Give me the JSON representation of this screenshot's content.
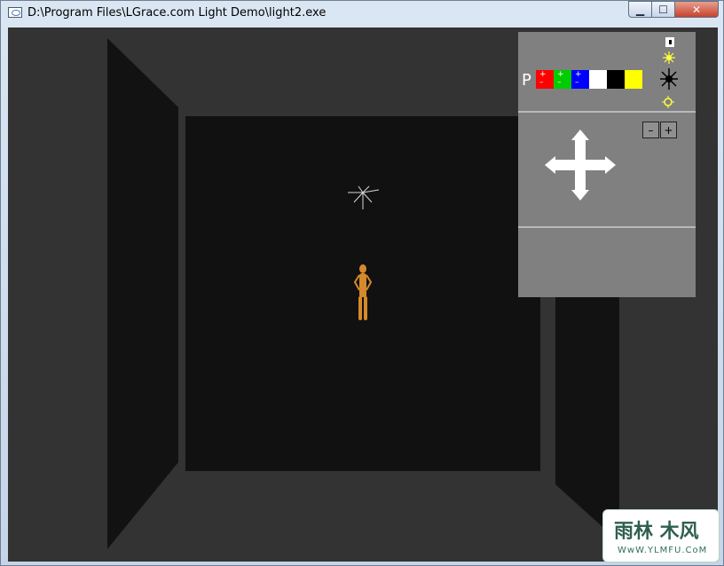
{
  "window": {
    "title": "D:\\Program Files\\LGrace.com Light Demo\\light2.exe"
  },
  "controls": {
    "minimize": "▁",
    "maximize": "☐",
    "close": "✕"
  },
  "panel": {
    "p_label": "P",
    "swatches": [
      {
        "color": "#ff0000",
        "plus": "+",
        "minus": "–"
      },
      {
        "color": "#00cc00",
        "plus": "+",
        "minus": "–"
      },
      {
        "color": "#0000ff",
        "plus": "+",
        "minus": "–"
      },
      {
        "color": "#ffffff"
      },
      {
        "color": "#000000"
      },
      {
        "color": "#ffff00"
      }
    ],
    "minus_button": "–",
    "plus_button": "+"
  },
  "watermark": {
    "line1": "雨林 木风",
    "line2": "WwW.YLMFU.CoM"
  }
}
